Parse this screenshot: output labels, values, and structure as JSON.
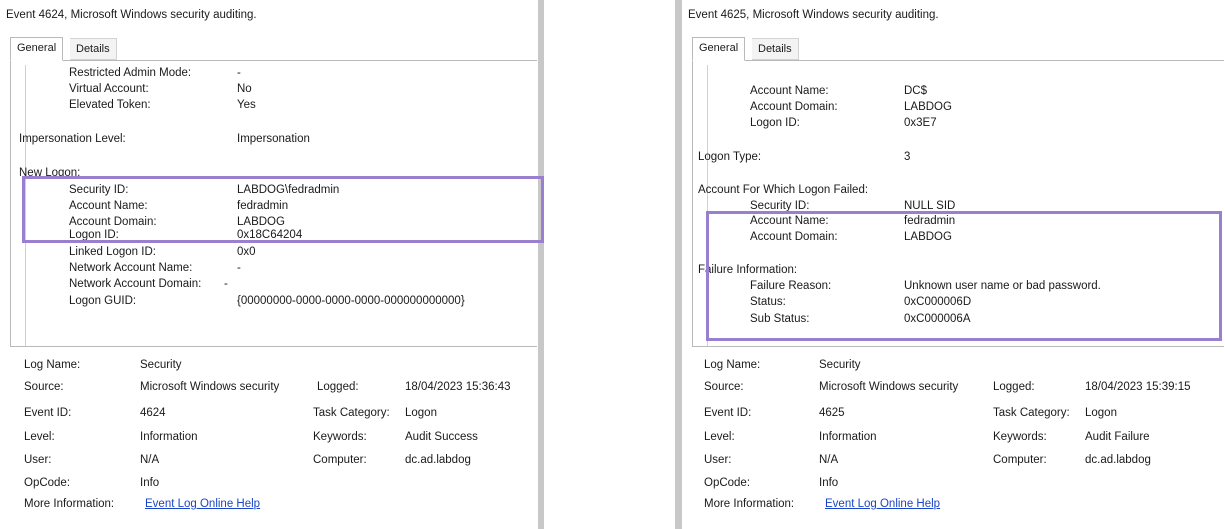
{
  "left": {
    "title": "Event 4624, Microsoft Windows security auditing.",
    "tabs": [
      "General",
      "Details"
    ],
    "detail": {
      "restricted_admin_mode_k": "Restricted Admin Mode:",
      "restricted_admin_mode_v": "-",
      "virtual_account_k": "Virtual Account:",
      "virtual_account_v": "No",
      "elevated_token_k": "Elevated Token:",
      "elevated_token_v": "Yes",
      "impersonation_level_k": "Impersonation Level:",
      "impersonation_level_v": "Impersonation",
      "new_logon_k": "New Logon:",
      "security_id_k": "Security ID:",
      "security_id_v": "LABDOG\\fedradmin",
      "account_name_k": "Account Name:",
      "account_name_v": "fedradmin",
      "account_domain_k": "Account Domain:",
      "account_domain_v": "LABDOG",
      "logon_id_k": "Logon ID:",
      "logon_id_v": "0x18C64204",
      "linked_logon_id_k": "Linked Logon ID:",
      "linked_logon_id_v": "0x0",
      "network_account_name_k": "Network Account Name:",
      "network_account_name_v": "-",
      "network_account_domain_k": "Network Account Domain:",
      "network_account_domain_v": "-",
      "logon_guid_k": "Logon GUID:",
      "logon_guid_v": "{00000000-0000-0000-0000-000000000000}"
    },
    "meta": {
      "log_name_k": "Log Name:",
      "log_name_v": "Security",
      "source_k": "Source:",
      "source_v": "Microsoft Windows security",
      "logged_k": "Logged:",
      "logged_v": "18/04/2023 15:36:43",
      "event_id_k": "Event ID:",
      "event_id_v": "4624",
      "task_category_k": "Task Category:",
      "task_category_v": "Logon",
      "level_k": "Level:",
      "level_v": "Information",
      "keywords_k": "Keywords:",
      "keywords_v": "Audit Success",
      "user_k": "User:",
      "user_v": "N/A",
      "computer_k": "Computer:",
      "computer_v": "dc.ad.labdog",
      "opcode_k": "OpCode:",
      "opcode_v": "Info",
      "more_info_k": "More Information:",
      "more_info_link": "Event Log Online Help"
    }
  },
  "right": {
    "title": "Event 4625, Microsoft Windows security auditing.",
    "tabs": [
      "General",
      "Details"
    ],
    "detail": {
      "account_name_k": "Account Name:",
      "account_name_v": "DC$",
      "account_domain_k": "Account Domain:",
      "account_domain_v": "LABDOG",
      "logon_id_k": "Logon ID:",
      "logon_id_v": "0x3E7",
      "logon_type_k": "Logon Type:",
      "logon_type_v": "3",
      "failed_header": "Account For Which Logon Failed:",
      "f_security_id_k": "Security ID:",
      "f_security_id_v": "NULL SID",
      "f_account_name_k": "Account Name:",
      "f_account_name_v": "fedradmin",
      "f_account_domain_k": "Account Domain:",
      "f_account_domain_v": "LABDOG",
      "failure_header": "Failure Information:",
      "failure_reason_k": "Failure Reason:",
      "failure_reason_v": "Unknown user name or bad password.",
      "status_k": "Status:",
      "status_v": "0xC000006D",
      "sub_status_k": "Sub Status:",
      "sub_status_v": "0xC000006A"
    },
    "meta": {
      "log_name_k": "Log Name:",
      "log_name_v": "Security",
      "source_k": "Source:",
      "source_v": "Microsoft Windows security",
      "logged_k": "Logged:",
      "logged_v": "18/04/2023 15:39:15",
      "event_id_k": "Event ID:",
      "event_id_v": "4625",
      "task_category_k": "Task Category:",
      "task_category_v": "Logon",
      "level_k": "Level:",
      "level_v": "Information",
      "keywords_k": "Keywords:",
      "keywords_v": "Audit Failure",
      "user_k": "User:",
      "user_v": "N/A",
      "computer_k": "Computer:",
      "computer_v": "dc.ad.labdog",
      "opcode_k": "OpCode:",
      "opcode_v": "Info",
      "more_info_k": "More Information:",
      "more_info_link": "Event Log Online Help"
    }
  },
  "colors": {
    "highlight": "#9a7fd1",
    "link": "#1a45c9",
    "separator": "#c8c8c8"
  }
}
